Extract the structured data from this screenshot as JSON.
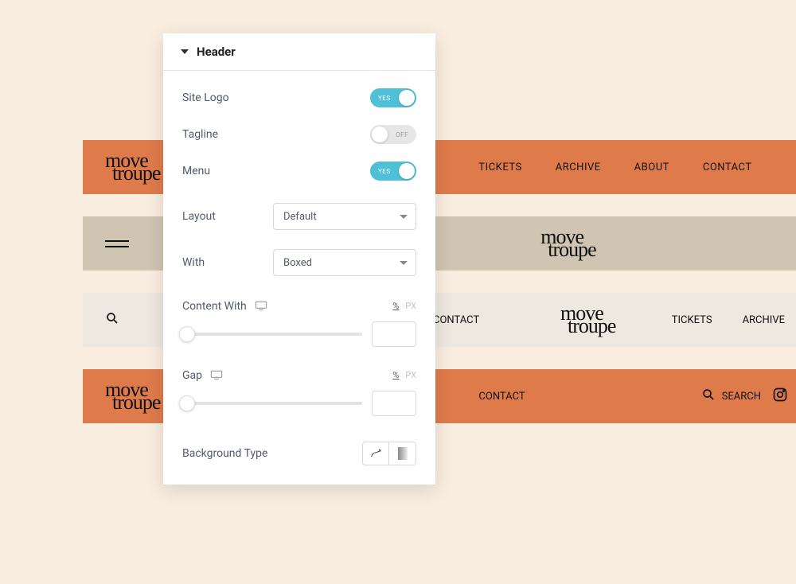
{
  "logo": {
    "line1": "move",
    "line2": "troupe"
  },
  "nav": {
    "tickets": "TICKETS",
    "archive": "ARCHIVE",
    "about": "ABOUT",
    "contact": "CONTACT",
    "search": "SEARCH"
  },
  "panel": {
    "title": "Header",
    "siteLogo": {
      "label": "Site Logo",
      "state": "YES"
    },
    "tagline": {
      "label": "Tagline",
      "state": "OFF"
    },
    "menu": {
      "label": "Menu",
      "state": "YES"
    },
    "layout": {
      "label": "Layout",
      "value": "Default"
    },
    "width": {
      "label": "With",
      "value": "Boxed"
    },
    "contentWidth": {
      "label": "Content With",
      "unit_pct": "%",
      "unit_px": "PX",
      "value": ""
    },
    "gap": {
      "label": "Gap",
      "unit_pct": "%",
      "unit_px": "PX",
      "value": ""
    },
    "bgType": {
      "label": "Background Type"
    }
  }
}
